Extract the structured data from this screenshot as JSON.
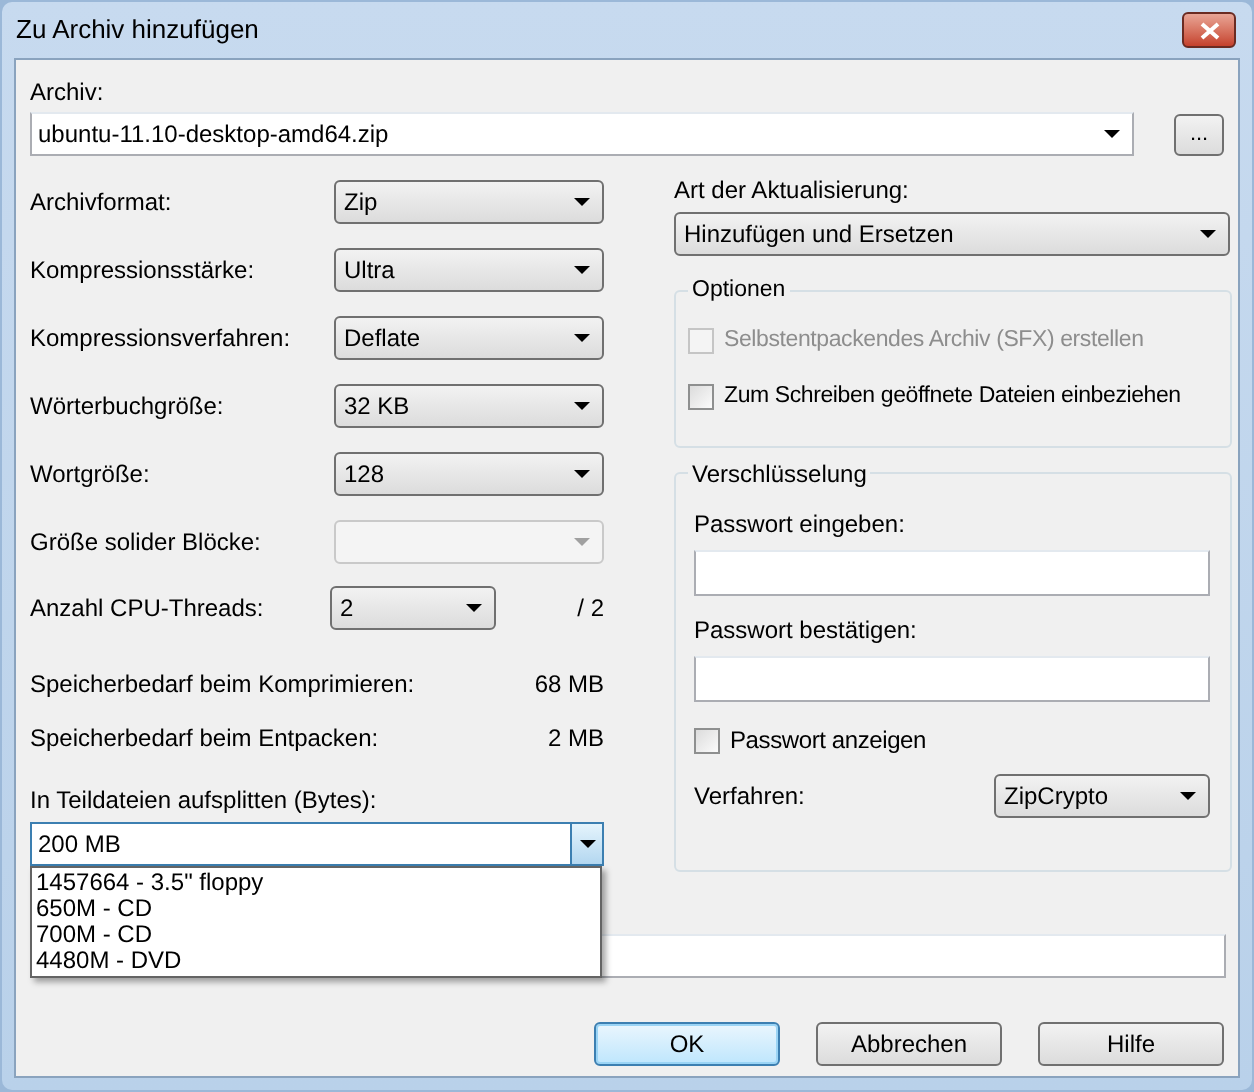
{
  "window": {
    "title": "Zu Archiv hinzufügen"
  },
  "archive": {
    "label": "Archiv:",
    "value": "ubuntu-11.10-desktop-amd64.zip",
    "browse": "..."
  },
  "settings": [
    {
      "label": "Archivformat:",
      "value": "Zip",
      "disabled": false
    },
    {
      "label": "Kompressionsstärke:",
      "value": "Ultra",
      "disabled": false
    },
    {
      "label": "Kompressionsverfahren:",
      "value": "Deflate",
      "disabled": false
    },
    {
      "label": "Wörterbuchgröße:",
      "value": "32 KB",
      "disabled": false
    },
    {
      "label": "Wortgröße:",
      "value": "128",
      "disabled": false
    },
    {
      "label": "Größe solider Blöcke:",
      "disabled": true
    }
  ],
  "cpu_threads": {
    "label": "Anzahl CPU-Threads:",
    "value": "2",
    "max": "/ 2"
  },
  "memory": [
    {
      "label": "Speicherbedarf beim Komprimieren:",
      "value": "68 MB"
    },
    {
      "label": "Speicherbedarf beim Entpacken:",
      "value": "2 MB"
    }
  ],
  "split": {
    "label": "In Teildateien aufsplitten (Bytes):",
    "value": "200 MB",
    "expanded": true,
    "options": [
      "1457664 - 3.5\" floppy",
      "650M - CD",
      "700M - CD",
      "4480M - DVD"
    ]
  },
  "update_mode": {
    "label": "Art der Aktualisierung:",
    "value": "Hinzufügen und Ersetzen"
  },
  "options": {
    "title": "Optionen",
    "items": [
      {
        "label": "Selbstentpackendes Archiv (SFX) erstellen",
        "checked": false,
        "disabled": true
      },
      {
        "label": "Zum Schreiben geöffnete Dateien einbeziehen",
        "checked": false,
        "disabled": false
      }
    ]
  },
  "encryption": {
    "title": "Verschlüsselung",
    "fields": [
      {
        "label": "Passwort eingeben:"
      },
      {
        "label": "Passwort bestätigen:"
      }
    ],
    "show_password": {
      "label": "Passwort anzeigen",
      "checked": false
    },
    "method": {
      "label": "Verfahren:",
      "value": "ZipCrypto"
    }
  },
  "buttons": [
    {
      "label": "OK",
      "default": true
    },
    {
      "label": "Abbrechen",
      "default": false
    },
    {
      "label": "Hilfe",
      "default": false
    }
  ]
}
